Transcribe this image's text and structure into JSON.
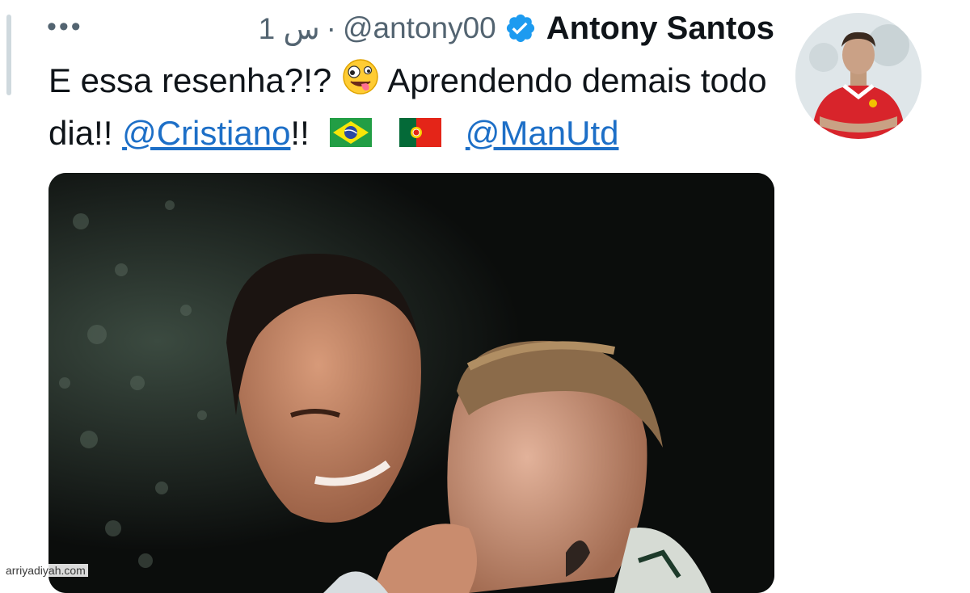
{
  "tweet": {
    "more_label": "•••",
    "time_ago": "1 س",
    "separator": "·",
    "handle": "@antony00",
    "display_name": "Antony Santos",
    "verified": true,
    "text_part1": "E essa resenha?!?",
    "text_part2": "Aprendendo demais todo dia!!",
    "mention_cristiano": "@Cristiano",
    "text_part3": "!!",
    "mention_manutd": "@ManUtd",
    "emojis": [
      "zany-face",
      "flag-brazil",
      "flag-portugal"
    ],
    "media_alt": "photo"
  },
  "watermark": "arriyadiyah.com",
  "colors": {
    "link": "#1d6fc7",
    "verified": "#1d9bf0",
    "muted": "#536471"
  }
}
